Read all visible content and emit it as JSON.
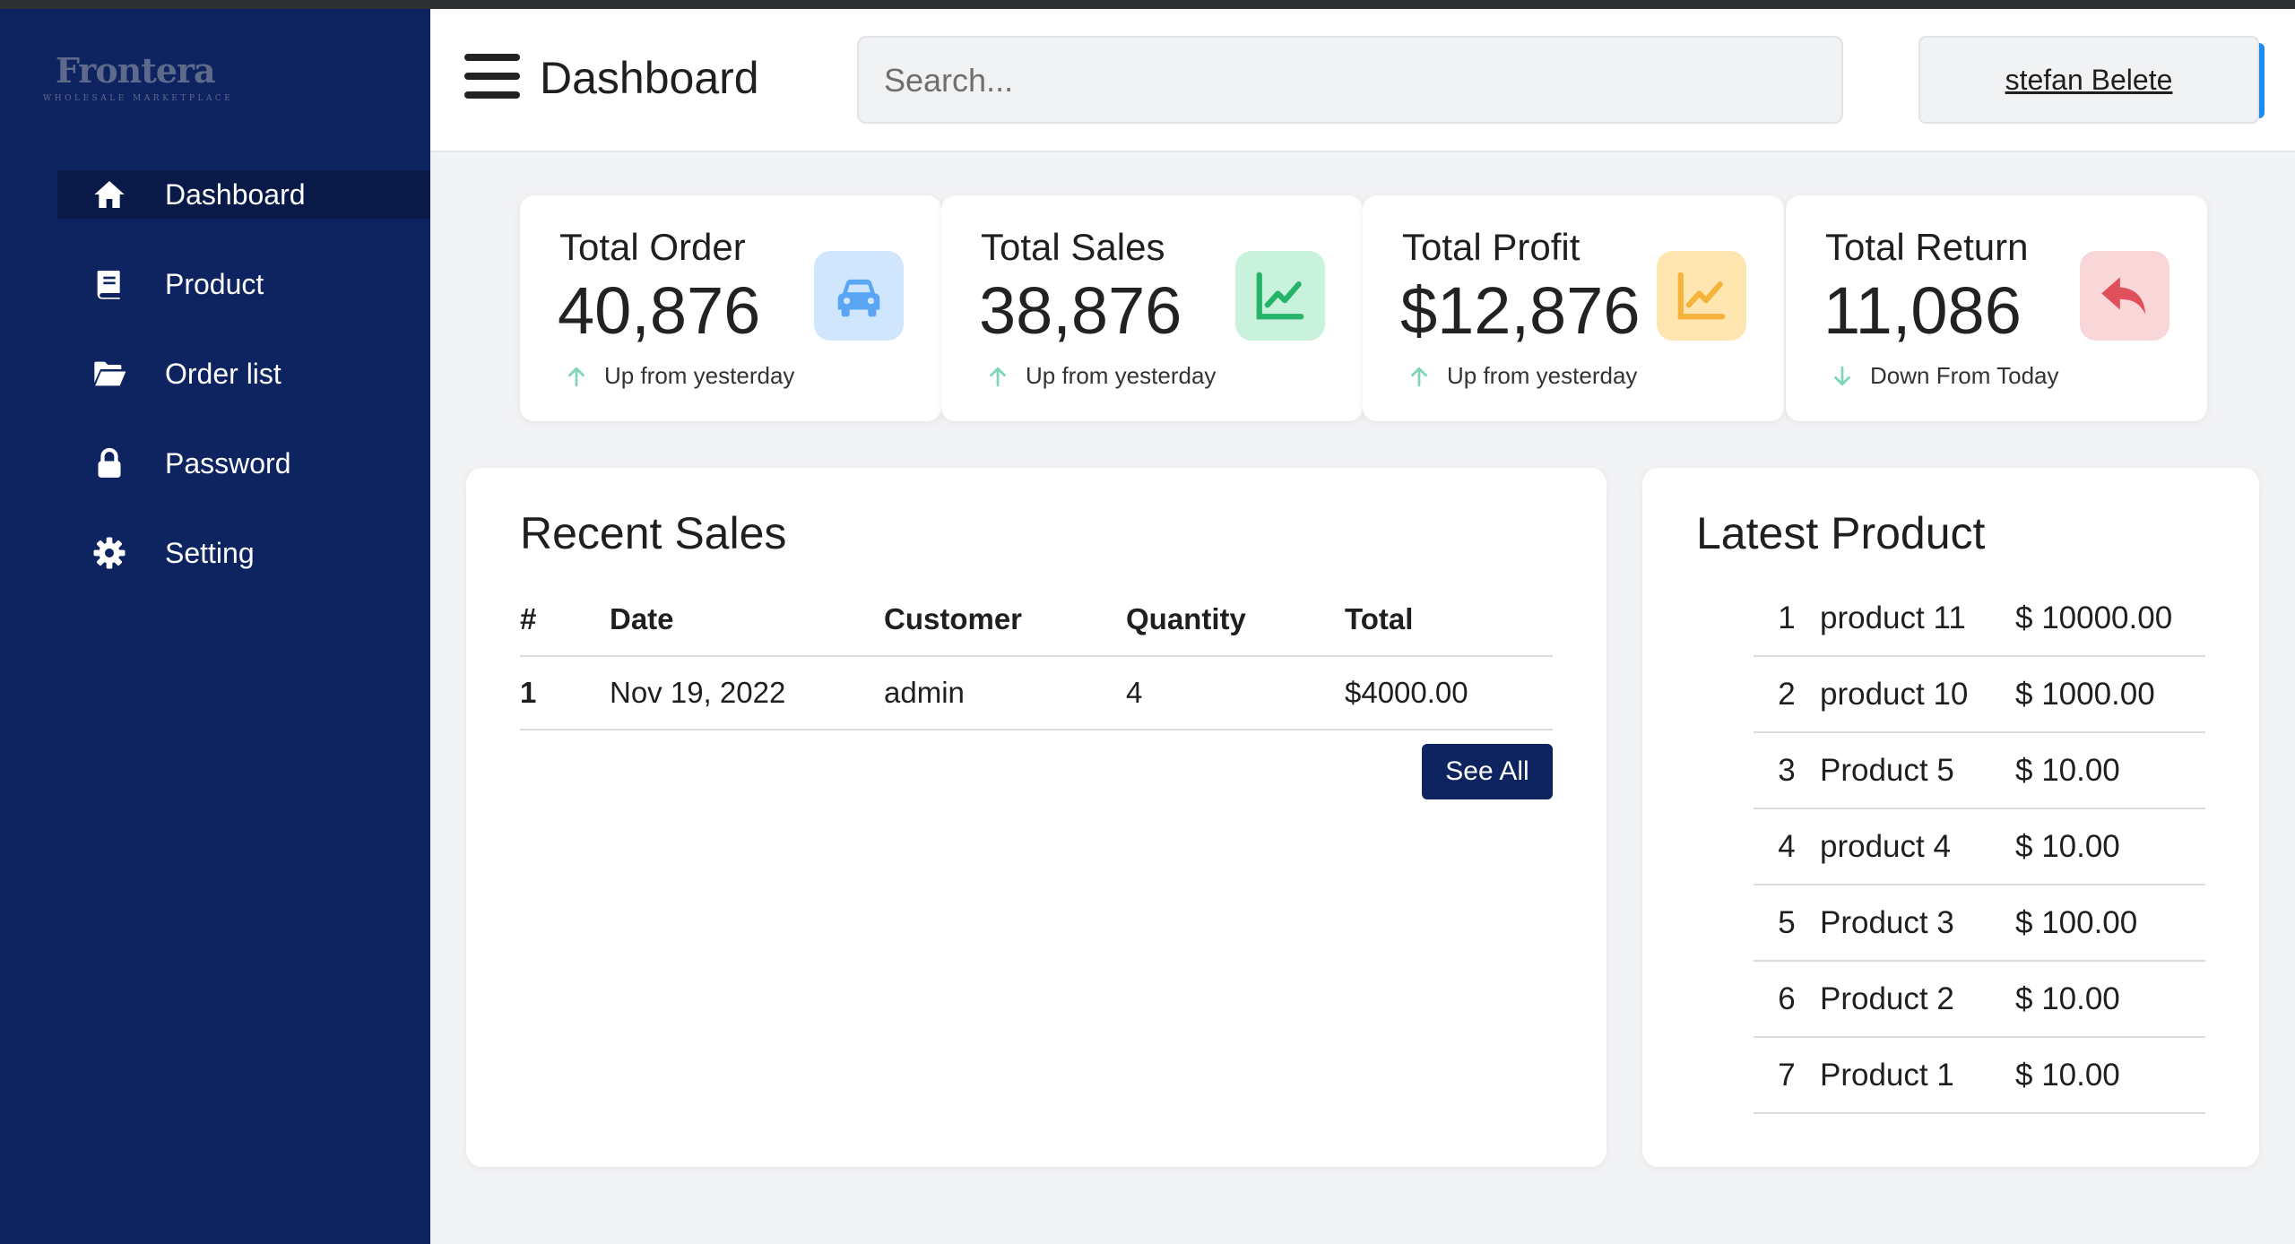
{
  "brand": {
    "name": "Frontera",
    "tagline": "WHOLESALE MARKETPLACE"
  },
  "sidebar": {
    "items": [
      {
        "label": "Dashboard",
        "icon": "home-icon",
        "active": true
      },
      {
        "label": "Product",
        "icon": "book-icon",
        "active": false
      },
      {
        "label": "Order list",
        "icon": "folder-open-icon",
        "active": false
      },
      {
        "label": "Password",
        "icon": "lock-icon",
        "active": false
      },
      {
        "label": "Setting",
        "icon": "gear-icon",
        "active": false
      }
    ]
  },
  "header": {
    "title": "Dashboard",
    "search_placeholder": "Search...",
    "user_name": "stefan Belete"
  },
  "stats": [
    {
      "title": "Total Order",
      "value": "40,876",
      "trend": "Up from yesterday",
      "direction": "up",
      "icon": "car-icon",
      "icon_bg": "#cfe6fd",
      "icon_color": "#5aa6f5"
    },
    {
      "title": "Total Sales",
      "value": "38,876",
      "trend": "Up from yesterday",
      "direction": "up",
      "icon": "chart-line-icon",
      "icon_bg": "#c9f2dc",
      "icon_color": "#26b36a"
    },
    {
      "title": "Total Profit",
      "value": "$12,876",
      "trend": "Up from yesterday",
      "direction": "up",
      "icon": "chart-line-icon",
      "icon_bg": "#ffe6b0",
      "icon_color": "#f6b33b"
    },
    {
      "title": "Total Return",
      "value": "11,086",
      "trend": "Down From Today",
      "direction": "down",
      "icon": "reply-icon",
      "icon_bg": "#f9d6d8",
      "icon_color": "#e0505c"
    }
  ],
  "recent_sales": {
    "title": "Recent Sales",
    "columns": [
      "#",
      "Date",
      "Customer",
      "Quantity",
      "Total"
    ],
    "rows": [
      [
        "1",
        "Nov 19, 2022",
        "admin",
        "4",
        "$4000.00"
      ]
    ],
    "see_all_label": "See All"
  },
  "latest_product": {
    "title": "Latest Product",
    "rows": [
      {
        "num": "1",
        "name": "product 11",
        "price": "$ 10000.00"
      },
      {
        "num": "2",
        "name": "product 10",
        "price": "$ 1000.00"
      },
      {
        "num": "3",
        "name": "Product 5",
        "price": "$ 10.00"
      },
      {
        "num": "4",
        "name": "product 4",
        "price": "$ 10.00"
      },
      {
        "num": "5",
        "name": "Product 3",
        "price": "$ 100.00"
      },
      {
        "num": "6",
        "name": "Product 2",
        "price": "$ 10.00"
      },
      {
        "num": "7",
        "name": "Product 1",
        "price": "$ 10.00"
      }
    ]
  },
  "colors": {
    "sidebar_bg": "#0d2460",
    "accent": "#1a8cf0",
    "button_bg": "#0d2460",
    "trend_up": "#7fd6b5",
    "trend_down": "#7fd6b5"
  }
}
